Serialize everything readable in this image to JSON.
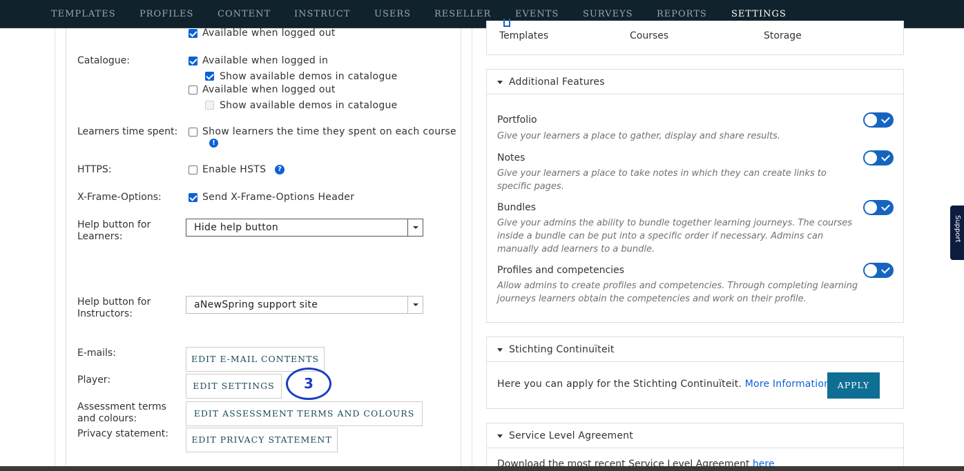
{
  "nav": {
    "items": [
      "TEMPLATES",
      "PROFILES",
      "CONTENT",
      "INSTRUCT",
      "USERS",
      "RESELLER",
      "EVENTS",
      "SURVEYS",
      "REPORTS",
      "SETTINGS"
    ],
    "active": "SETTINGS"
  },
  "left": {
    "catalogue_label": "Catalogue:",
    "avail_logged_out_top": "Available when logged out",
    "avail_logged_in": "Available when logged in",
    "show_demos_1": "Show available demos in catalogue",
    "avail_logged_out": "Available when logged out",
    "show_demos_2": "Show available demos in catalogue",
    "time_label": "Learners time spent:",
    "time_option": "Show learners the time they spent on each course",
    "https_label": "HTTPS:",
    "hsts_option": "Enable HSTS",
    "xframe_label": "X-Frame-Options:",
    "xframe_option": "Send X-Frame-Options Header",
    "help_learners_label_1": "Help button for",
    "help_learners_label_2": "Learners:",
    "help_learners_value": "Hide help button",
    "help_instructors_label_1": "Help button for",
    "help_instructors_label_2": "Instructors:",
    "help_instructors_value": "aNewSpring support site",
    "emails_label": "E-mails:",
    "emails_button": "EDIT E-MAIL CONTENTS",
    "player_label": "Player:",
    "player_button": "EDIT SETTINGS",
    "assessment_label_1": "Assessment terms",
    "assessment_label_2": "and colours:",
    "assessment_button": "EDIT ASSESSMENT TERMS AND COLOURS",
    "privacy_label": "Privacy statement:",
    "privacy_button": "EDIT PRIVACY STATEMENT",
    "annotation": "3"
  },
  "right": {
    "top_items": [
      "Templates",
      "Courses",
      "Storage"
    ],
    "additional_features_title": "Additional Features",
    "features": [
      {
        "title": "Portfolio",
        "desc": "Give your learners a place to gather, display and share results."
      },
      {
        "title": "Notes",
        "desc": "Give your learners a place to take notes in which they can create links to specific pages."
      },
      {
        "title": "Bundles",
        "desc": "Give your admins the ability to bundle together learning journeys. The courses inside a bundle can be put into a specific order if necessary. Admins can manually add learners to a bundle."
      },
      {
        "title": "Profiles and competencies",
        "desc": "Allow admins to create profiles and competencies. Through completing learning journeys learners obtain the competencies and work on their profile."
      }
    ],
    "stichting_title": "Stichting Continuïteit",
    "stichting_text": "Here you can apply for the Stichting Continuïteit.",
    "stichting_link": "More Information",
    "apply_button": "APPLY",
    "sla_title": "Service Level Agreement",
    "sla_text": "Download the most recent Service Level Agreement",
    "sla_link": "here"
  },
  "support_tab": "Support"
}
